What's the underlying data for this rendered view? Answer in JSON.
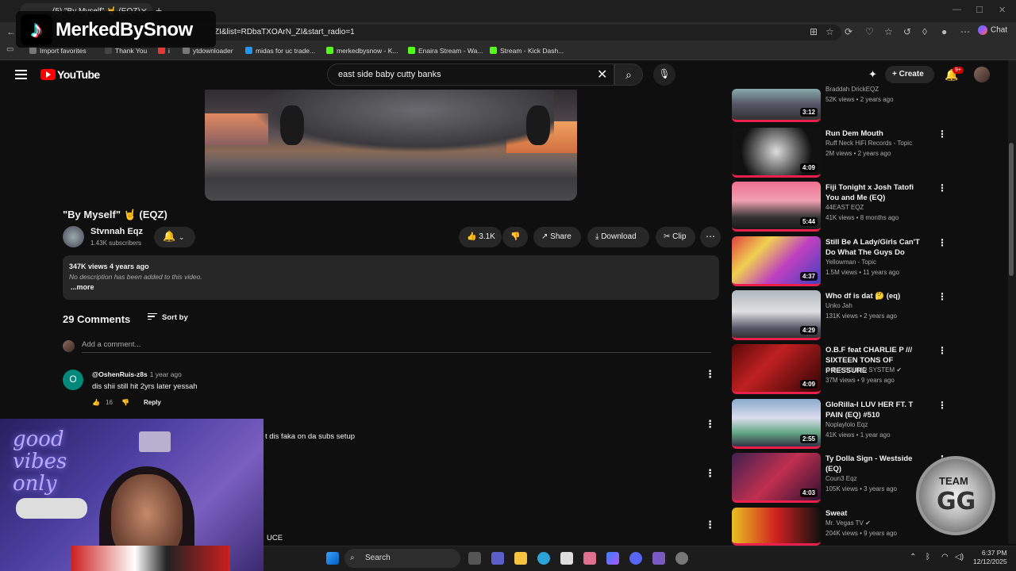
{
  "browser": {
    "tab_title": "(5) \"By Myself\" 🤘 (EQZ)",
    "url": "ZI&list=RDbaTXOArN_ZI&start_radio=1",
    "chat_label": "Chat",
    "bookmarks": [
      {
        "label": "Import favorites",
        "color": "#777"
      },
      {
        "label": "Thank You",
        "color": "#444"
      },
      {
        "label": "i",
        "color": "#e53935"
      },
      {
        "label": "ytdownloader",
        "color": "#777"
      },
      {
        "label": "midas for uc trade...",
        "color": "#2196f3"
      },
      {
        "label": "merkedbysnow - K...",
        "color": "#53fc18"
      },
      {
        "label": "Enaira Stream - Wa...",
        "color": "#53fc18"
      },
      {
        "label": "Stream - Kick Dash...",
        "color": "#53fc18"
      }
    ]
  },
  "overlay": {
    "tiktok_name": "MerkedBySnow",
    "team_top": "TEAM",
    "team_big": "GG"
  },
  "youtube": {
    "logo_text": "YouTube",
    "search_query": "east side baby cutty banks",
    "create_label": "Create",
    "notif_badge": "9+"
  },
  "video": {
    "title": "\"By Myself\" 🤘 (EQZ)",
    "channel": "Stvnnah Eqz",
    "subscribers": "1.43K subscribers",
    "likes": "3.1K",
    "share_label": "Share",
    "download_label": "Download",
    "clip_label": "Clip",
    "views_date": "347K views  4 years ago",
    "description": "No description has been added to this video.",
    "more_label": "...more"
  },
  "comments": {
    "count": "29 Comments",
    "sort_label": "Sort by",
    "add_placeholder": "Add a comment...",
    "items": [
      {
        "avatar": "O",
        "user": "@OshenRuis-z8s",
        "time": "1 year ago",
        "text": "dis shii still hit 2yrs later yessah",
        "likes": "16",
        "reply": "Reply"
      }
    ],
    "partial_1": "t dis faka on da subs setup",
    "partial_2": "UCE"
  },
  "webcam": {
    "neon_text": "good vibes only"
  },
  "sidebar": [
    {
      "title": "",
      "channel": "Braddah DrickEQZ",
      "meta": "52K views • 2 years ago",
      "duration": "3:12",
      "thumb": "linear-gradient(180deg,#8aa 0%,#556 50%,#333 100%)"
    },
    {
      "title": "Run Dem Mouth",
      "channel": "Ruff Neck HiFi Records - Topic",
      "meta": "2M views • 2 years ago",
      "duration": "4:09",
      "thumb": "radial-gradient(circle,#ddd 0%,#777 35%,#111 70%)"
    },
    {
      "title": "Fiji Tonight x Josh Tatofi You and Me (EQ)",
      "channel": "44EAST EQZ",
      "meta": "41K views • 8 months ago",
      "duration": "5:44",
      "thumb": "linear-gradient(180deg,#f07090 0%,#f0a0b0 40%,#333 75%,#1a1a1a 100%)"
    },
    {
      "title": "Still Be A Lady/Girls Can'T Do What The Guys Do",
      "channel": "Yellowman - Topic",
      "meta": "1.5M views • 11 years ago",
      "duration": "4:37",
      "thumb": "linear-gradient(135deg,#e04040 0%,#f0d050 30%,#c040c0 60%,#4040c0 100%)"
    },
    {
      "title": "Who df is dat 🤔 (eq)",
      "channel": "Unko Jah",
      "meta": "131K views • 2 years ago",
      "duration": "4:29",
      "thumb": "linear-gradient(180deg,#b0b8c0 0%,#e0e0e0 45%,#556 80%,#333 100%)"
    },
    {
      "title": "O.B.F feat CHARLIE P /// SIXTEEN TONS OF PRESSURE",
      "channel": "O.B.F SOUND SYSTEM ✔",
      "meta": "37M views • 9 years ago",
      "duration": "4:09",
      "thumb": "linear-gradient(135deg,#5a0a0a 0%,#c02020 40%,#300505 100%)"
    },
    {
      "title": "GloRilla-I LUV HER FT. T PAIN (EQ) #510",
      "channel": "Noplaylolo Eqz",
      "meta": "41K views • 1 year ago",
      "duration": "2:55",
      "thumb": "linear-gradient(180deg,#8ac 0%,#dde 40%,#6a8 70%,#334 100%)"
    },
    {
      "title": "Ty Dolla Sign - Westside (EQ)",
      "channel": "Coun3 Eqz",
      "meta": "105K views • 3 years ago",
      "duration": "4:03",
      "thumb": "linear-gradient(135deg,#402050 0%,#c03050 50%,#301030 100%)"
    },
    {
      "title": "Sweat",
      "channel": "Mr. Vegas TV ✔",
      "meta": "204K views • 9 years ago",
      "duration": "",
      "thumb": "linear-gradient(90deg,#e8c020 0%,#d02020 50%,#111 100%)"
    }
  ],
  "taskbar": {
    "search_label": "Search",
    "time": "6:37 PM",
    "date": "12/12/2025"
  }
}
